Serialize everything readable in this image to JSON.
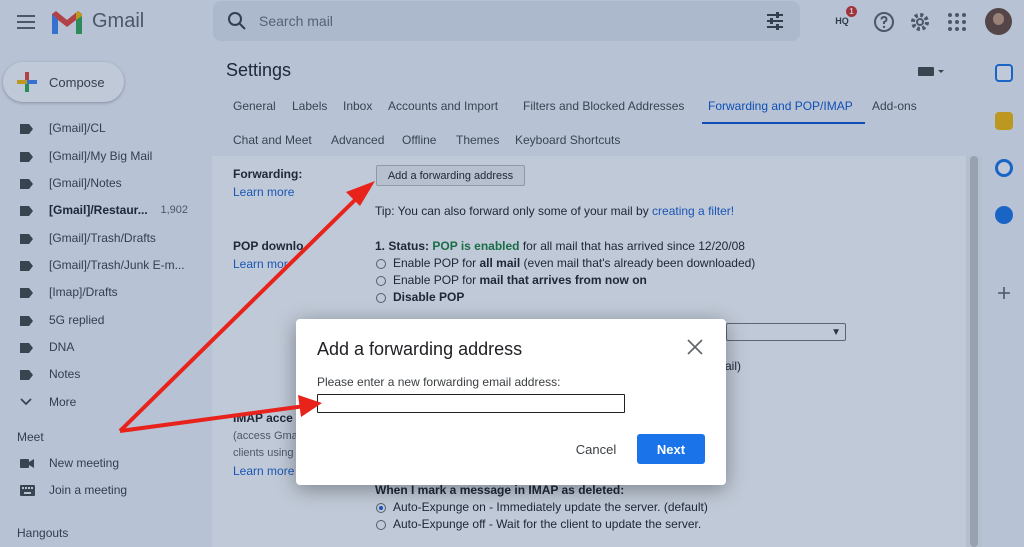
{
  "app": {
    "name": "Gmail"
  },
  "search": {
    "placeholder": "Search mail"
  },
  "compose": {
    "label": "Compose"
  },
  "sidebar": {
    "items": [
      {
        "label": "[Gmail]/CL",
        "count": "",
        "bold": false
      },
      {
        "label": "[Gmail]/My Big Mail",
        "count": "",
        "bold": false
      },
      {
        "label": "[Gmail]/Notes",
        "count": "",
        "bold": false
      },
      {
        "label": "[Gmail]/Restaur...",
        "count": "1,902",
        "bold": true
      },
      {
        "label": "[Gmail]/Trash/Drafts",
        "count": "",
        "bold": false
      },
      {
        "label": "[Gmail]/Trash/Junk E-m...",
        "count": "",
        "bold": false
      },
      {
        "label": "[Imap]/Drafts",
        "count": "",
        "bold": false
      },
      {
        "label": "5G replied",
        "count": "",
        "bold": false
      },
      {
        "label": "DNA",
        "count": "",
        "bold": false
      },
      {
        "label": "Notes",
        "count": "",
        "bold": false
      }
    ],
    "more_label": "More",
    "meet_title": "Meet",
    "meet_items": [
      "New meeting",
      "Join a meeting"
    ],
    "hangouts_title": "Hangouts"
  },
  "settings": {
    "title": "Settings",
    "tabs_row1": [
      "General",
      "Labels",
      "Inbox",
      "Accounts and Import",
      "Filters and Blocked Addresses",
      "Forwarding and POP/IMAP",
      "Add-ons"
    ],
    "tabs_row2": [
      "Chat and Meet",
      "Advanced",
      "Offline",
      "Themes",
      "Keyboard Shortcuts"
    ],
    "active_tab": "Forwarding and POP/IMAP",
    "forwarding": {
      "label": "Forwarding:",
      "learn_more": "Learn more",
      "button": "Add a forwarding address",
      "tip_prefix": "Tip: You can also forward only some of your mail by ",
      "tip_link": "creating a filter!"
    },
    "pop": {
      "label": "POP downlo",
      "learn_more": "Learn mor",
      "status_prefix": "1. Status: ",
      "status_value": "POP is enabled",
      "status_suffix": " for all mail that has arrived since 12/20/08",
      "opt1_a": "Enable POP for ",
      "opt1_b": "all mail",
      "opt1_c": " (even mail that's already been downloaded)",
      "opt2_a": "Enable POP for ",
      "opt2_b": "mail that arrives from now on",
      "opt3": "Disable POP",
      "tail": "ail)"
    },
    "imap": {
      "label": "IMAP acce",
      "sub1": "(access Gma",
      "sub2": "clients using",
      "learn_more": "Learn more",
      "delete_title": "When I mark a message in IMAP as deleted:",
      "opt1": "Auto-Expunge on - Immediately update the server. (default)",
      "opt2": "Auto-Expunge off - Wait for the client to update the server."
    }
  },
  "dialog": {
    "title": "Add a forwarding address",
    "prompt": "Please enter a new forwarding email address:",
    "input_value": "",
    "cancel": "Cancel",
    "next": "Next"
  },
  "colors": {
    "accent": "#0b57d0",
    "next_button": "#1a73e8",
    "pop_enabled": "#188038",
    "arrow": "#e8231c"
  },
  "badge": {
    "text": "HQ",
    "count": "1"
  }
}
